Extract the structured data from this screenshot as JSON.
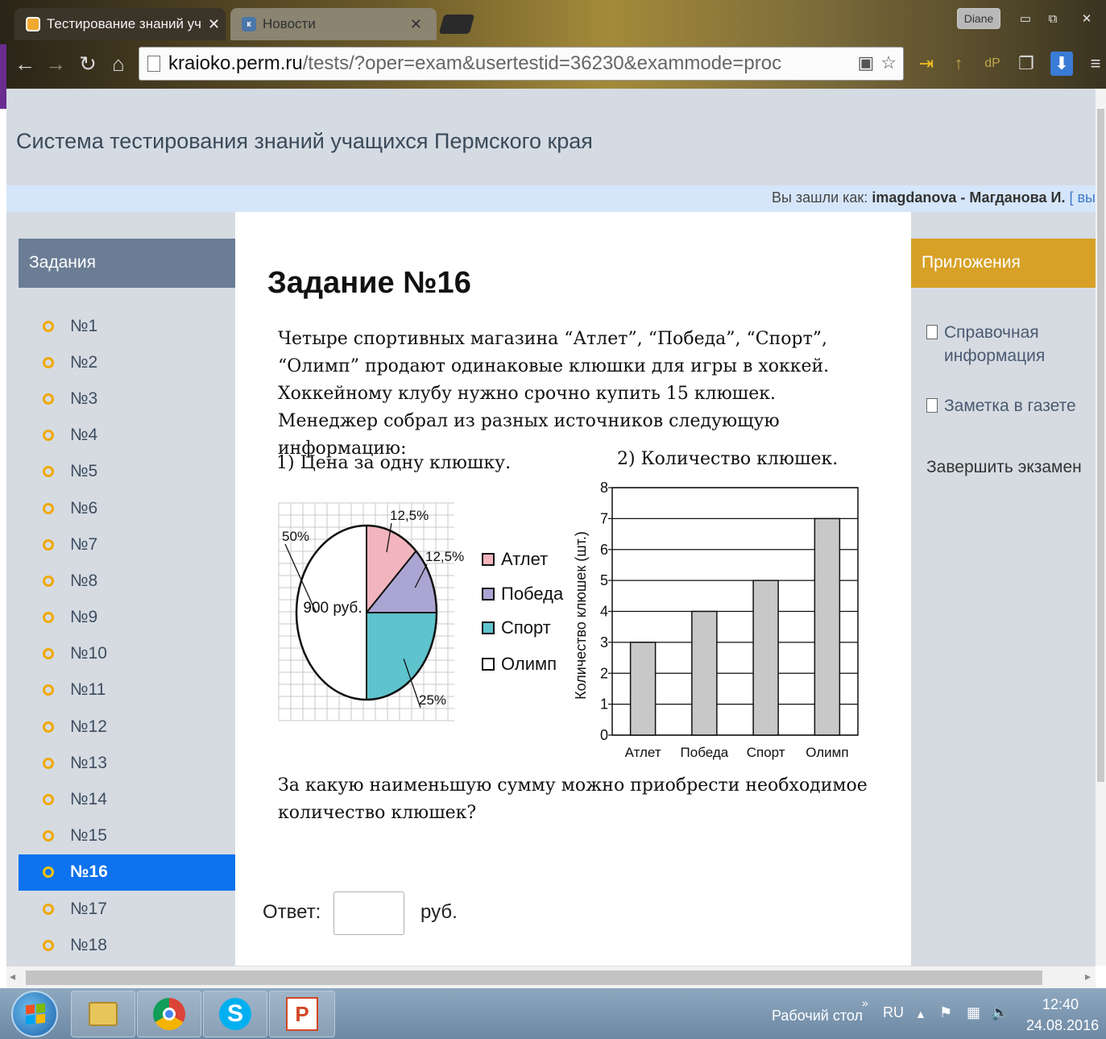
{
  "browser": {
    "tabs": [
      {
        "label": "Тестирование знаний уч",
        "active": true
      },
      {
        "label": "Новости",
        "active": false
      }
    ],
    "user_badge": "Diane",
    "url_host": "kraioko.perm.ru",
    "url_path": "/tests/?oper=exam&usertestid=36230&exammode=proc"
  },
  "site": {
    "title": "Система тестирования знаний учащихся Пермского края",
    "login_prefix": "Вы зашли как: ",
    "login_user": "imagdanova - Магданова И.",
    "login_exit": "[ вы"
  },
  "sidebar": {
    "title": "Задания",
    "items": [
      "№1",
      "№2",
      "№3",
      "№4",
      "№5",
      "№6",
      "№7",
      "№8",
      "№9",
      "№10",
      "№11",
      "№12",
      "№13",
      "№14",
      "№15",
      "№16",
      "№17",
      "№18"
    ],
    "selected_index": 15
  },
  "apps": {
    "title": "Приложения",
    "links": [
      "Справочная\nинформация",
      "Заметка в газете"
    ],
    "finish": "Завершить экзамен"
  },
  "task": {
    "title": "Задание №16",
    "text": "Четыре спортивных магазина “Атлет”, “Победа”, “Спорт”, “Олимп” продают одинаковые клюшки для игры в хоккей. Хоккейному клубу нужно срочно купить 15 клюшек. Менеджер собрал из разных источников следующую информацию:",
    "caption_pie": "1) Цена за одну клюшку.",
    "caption_bar": "2) Количество клюшек.",
    "question": "За какую наименьшую сумму можно приобрести необходимое количество клюшек?",
    "answer_label": "Ответ:",
    "answer_unit": "руб."
  },
  "chart_data": [
    {
      "type": "pie",
      "total_label": "900 руб.",
      "slices": [
        {
          "name": "Атлет",
          "value": 12.5,
          "label": "12,5%",
          "color": "#f2b5bd"
        },
        {
          "name": "Победа",
          "value": 12.5,
          "label": "12,5%",
          "color": "#aba5d3"
        },
        {
          "name": "Спорт",
          "value": 25,
          "label": "25%",
          "color": "#5ec3cd"
        },
        {
          "name": "Олимп",
          "value": 50,
          "label": "50%",
          "color": "#ffffff"
        }
      ],
      "legend_placement": "right"
    },
    {
      "type": "bar",
      "categories": [
        "Атлет",
        "Победа",
        "Спорт",
        "Олимп"
      ],
      "values": [
        3,
        4,
        5,
        7
      ],
      "ylabel": "Количество клюшек (шт.)",
      "ylim": [
        0,
        8
      ],
      "yticks": [
        0,
        1,
        2,
        3,
        4,
        5,
        6,
        7,
        8
      ],
      "grid": true,
      "bar_color": "#c8c8c8"
    }
  ],
  "taskbar": {
    "desktop_label": "Рабочий стол",
    "lang": "RU",
    "time": "12:40",
    "date": "24.08.2016"
  }
}
